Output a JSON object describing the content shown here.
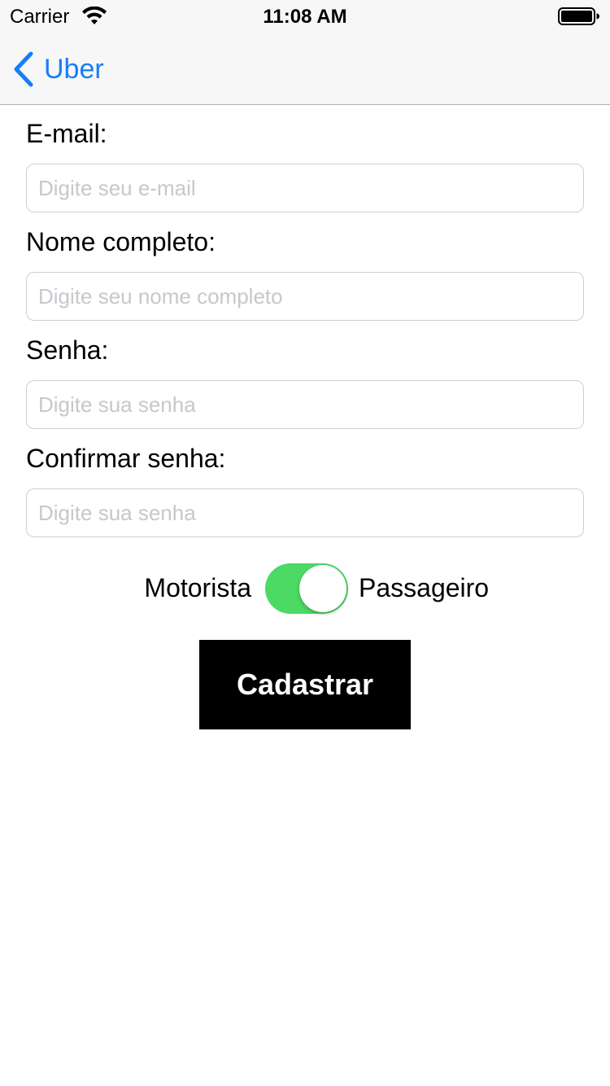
{
  "status_bar": {
    "carrier": "Carrier",
    "time": "11:08 AM"
  },
  "nav": {
    "back_label": "Uber",
    "accent_color": "#147efb"
  },
  "form": {
    "fields": [
      {
        "label": "E-mail:",
        "placeholder": "Digite seu e-mail",
        "value": ""
      },
      {
        "label": "Nome completo:",
        "placeholder": "Digite seu nome completo",
        "value": ""
      },
      {
        "label": "Senha:",
        "placeholder": "Digite sua senha",
        "value": ""
      },
      {
        "label": "Confirmar senha:",
        "placeholder": "Digite sua senha",
        "value": ""
      }
    ]
  },
  "user_type": {
    "left_label": "Motorista",
    "right_label": "Passageiro",
    "switch_on": true,
    "switch_color": "#4cd964"
  },
  "submit": {
    "label": "Cadastrar"
  }
}
